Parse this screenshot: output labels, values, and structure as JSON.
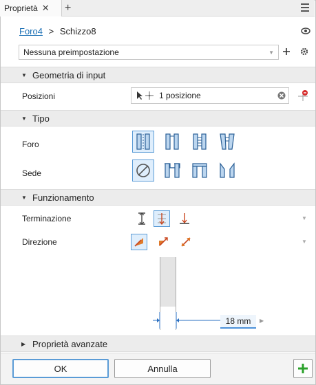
{
  "window": {
    "tab_label": "Proprietà",
    "new_tab": "+"
  },
  "breadcrumb": {
    "feature": "Foro4",
    "separator": ">",
    "sketch": "Schizzo8"
  },
  "preset": {
    "value": "Nessuna preimpostazione"
  },
  "sections": {
    "input_geometry": "Geometria di input",
    "type": "Tipo",
    "behavior": "Funzionamento",
    "advanced": "Proprietà avanzate"
  },
  "input_geometry": {
    "positions_label": "Posizioni",
    "positions_value": "1 posizione"
  },
  "type": {
    "hole_label": "Foro",
    "seat_label": "Sede"
  },
  "behavior": {
    "termination_label": "Terminazione",
    "direction_label": "Direzione"
  },
  "dimension": {
    "value": "18 mm"
  },
  "footer": {
    "ok": "OK",
    "cancel": "Annulla"
  },
  "colors": {
    "accent": "#1a6fb5",
    "selection": "#dfeefc",
    "selection_border": "#5a9bd6",
    "add_green": "#2aa12a",
    "arrow_orange": "#e07b2a"
  }
}
